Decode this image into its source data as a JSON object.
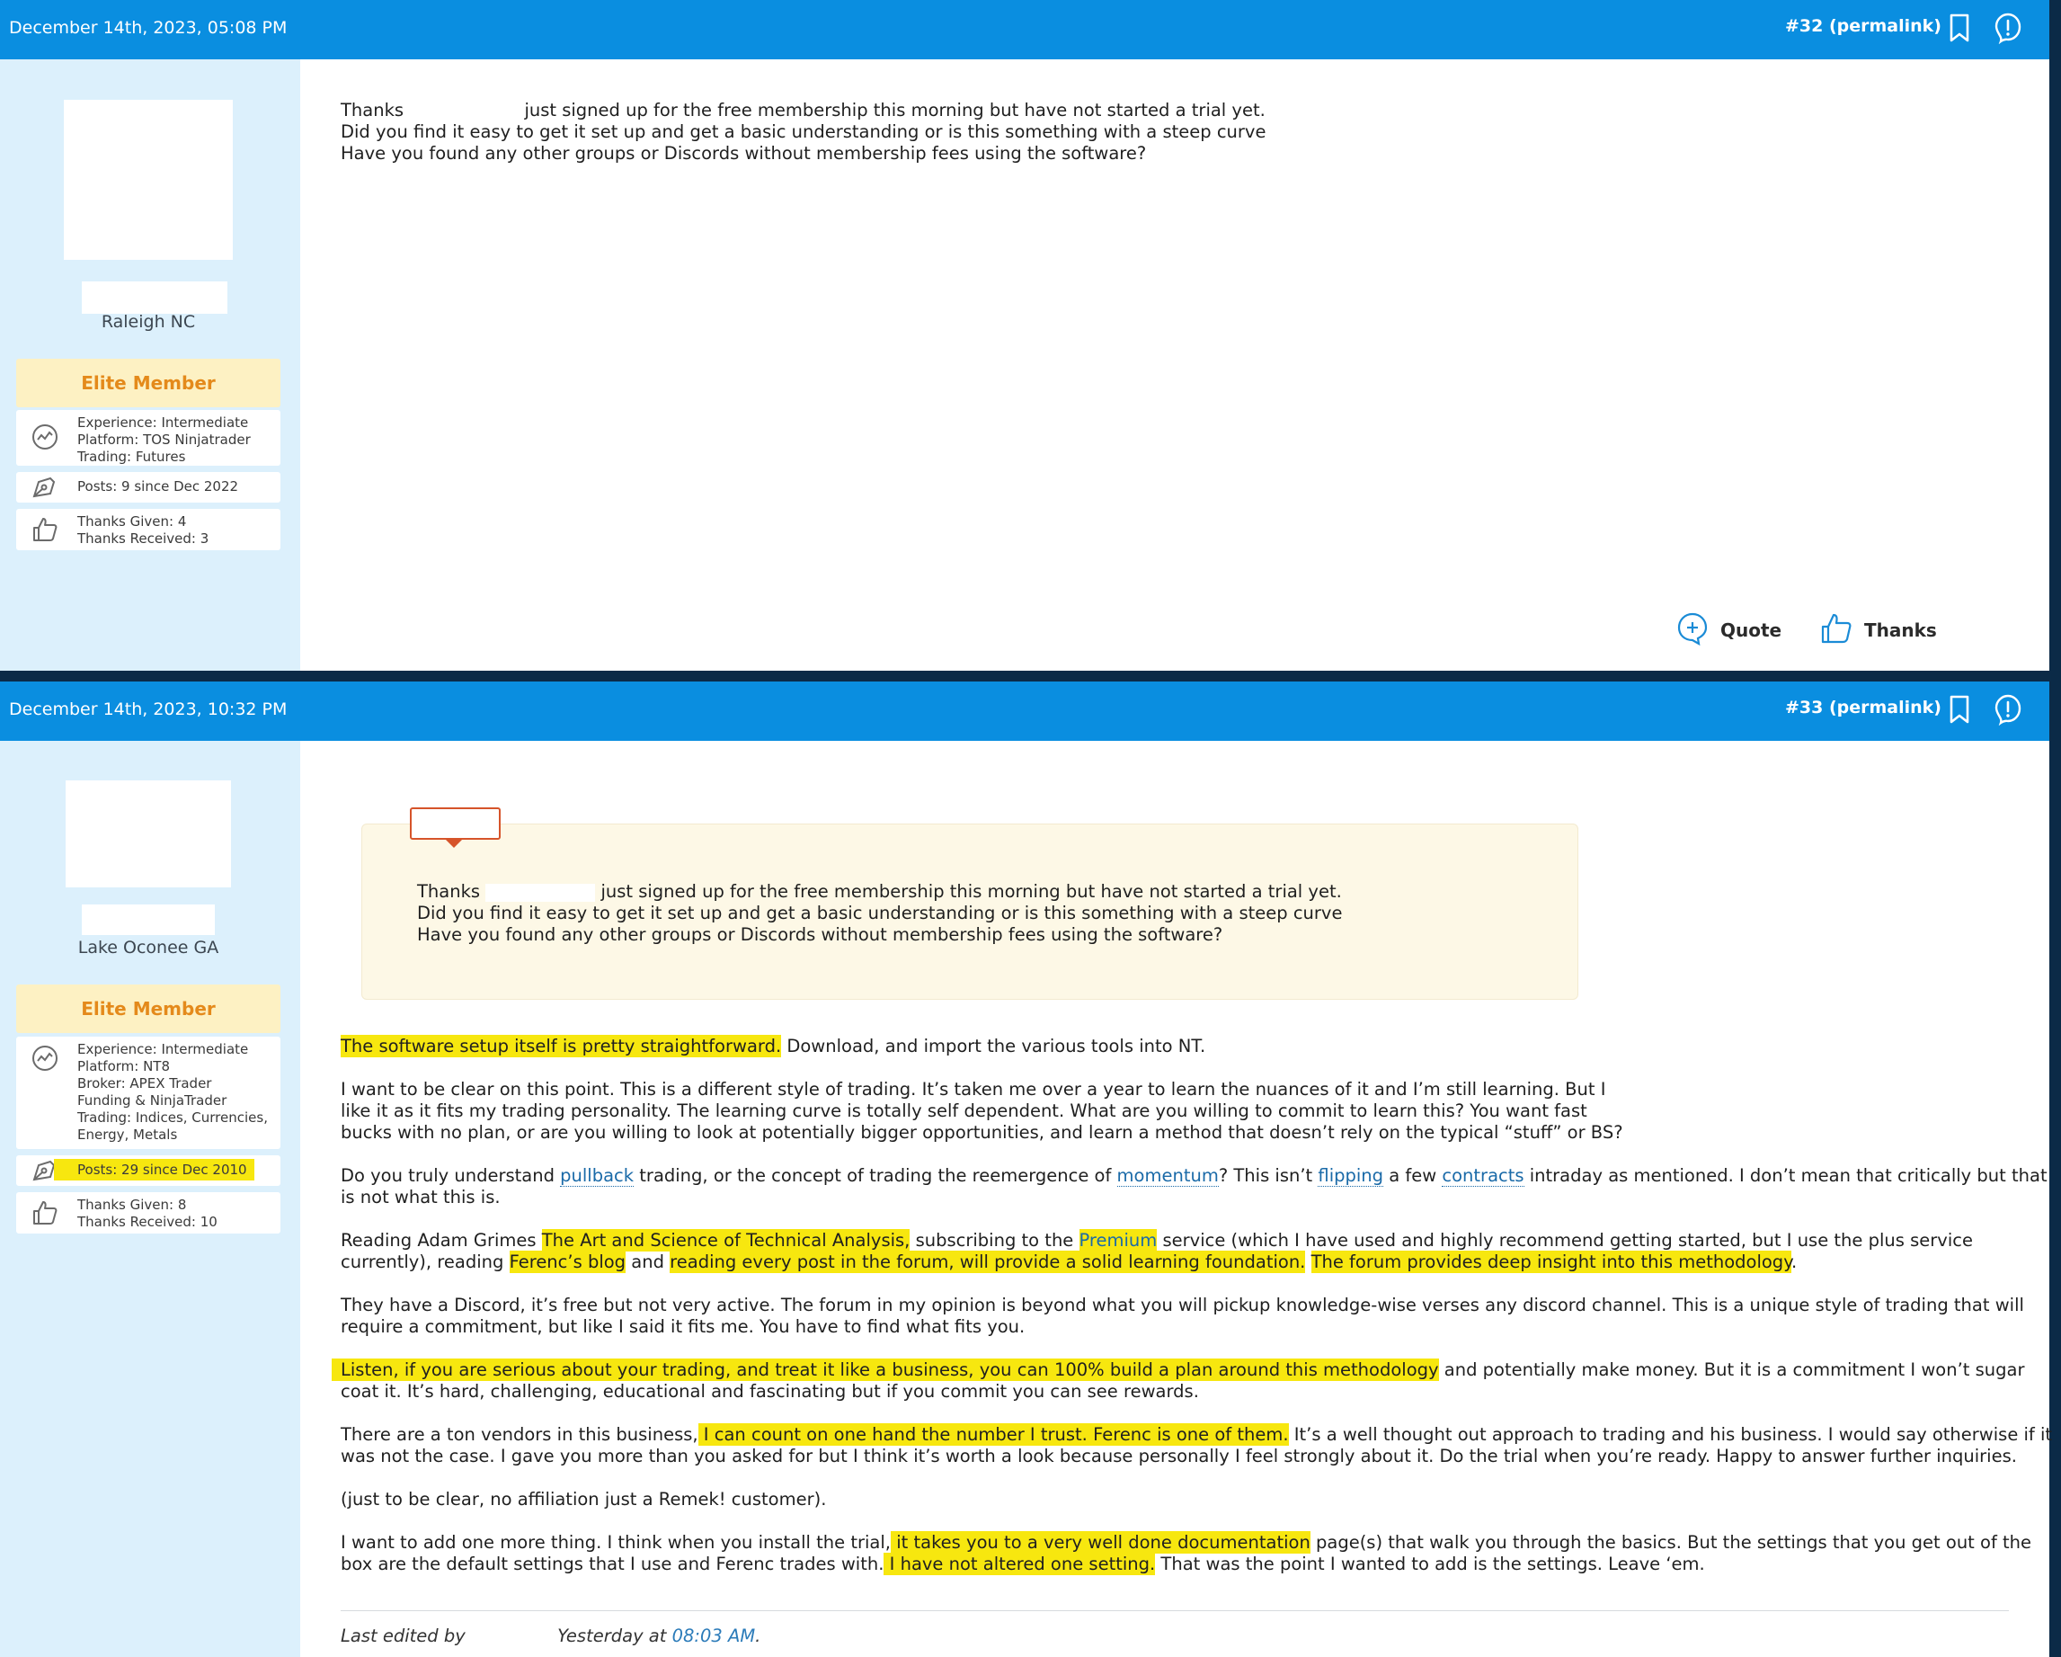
{
  "posts": [
    {
      "date": "December 14th, 2023, 05:08 PM",
      "permalink": "#32 (permalink)",
      "user": {
        "location": "Raleigh NC",
        "badge": "Elite Member",
        "experience": "Experience: Intermediate",
        "platform": "Platform: TOS Ninjatrader",
        "trading": "Trading: Futures",
        "posts": "Posts: 9 since Dec 2022",
        "thanks_given": "Thanks Given: 4",
        "thanks_received": "Thanks Received: 3"
      },
      "body": {
        "line1_a": "Thanks",
        "line1_b": "just signed up for the free membership this morning but have not started a trial yet.",
        "line2": "Did you find it easy to get it set up and get a basic understanding or is this something with a steep curve",
        "line3": "Have you found any other groups or Discords without membership fees using the software?"
      },
      "actions": {
        "quote": "Quote",
        "thanks": "Thanks"
      }
    },
    {
      "date": "December 14th, 2023, 10:32 PM",
      "permalink": "#33 (permalink)",
      "user": {
        "location": "Lake Oconee GA",
        "badge": "Elite Member",
        "experience": "Experience: Intermediate",
        "platform": "Platform: NT8",
        "broker1": "Broker: APEX Trader",
        "broker2": "Funding & NinjaTrader",
        "trading1": "Trading: Indices, Currencies,",
        "trading2": "Energy, Metals",
        "posts": "Posts: 29 since Dec 2010",
        "thanks_given": "Thanks Given: 8",
        "thanks_received": "Thanks Received: 10"
      },
      "quote": {
        "line1_a": "Thanks",
        "line1_b": "just signed up for the free membership this morning but have not started a trial yet.",
        "line2": "Did you find it easy to get it set up and get a basic understanding or is this something with a steep curve",
        "line3": "Have you found any other groups or Discords without membership fees using the software?"
      },
      "body": {
        "p1_hl": "The software setup itself is pretty straightforward.",
        "p1_rest": " Download, and import the various tools into NT.",
        "p2_l1": "I want to be clear on this point. This is a different style of trading. It’s taken me over a year to learn the nuances of it and I’m still learning. But I",
        "p2_l2": "like it as it fits my trading personality. The learning curve is totally self dependent. What are you willing to commit to learn this? You want fast",
        "p2_l3": "bucks with no plan, or are you willing to look at potentially bigger opportunities, and learn a method that doesn’t rely on the typical “stuff” or BS?",
        "p3_a": "Do you truly understand ",
        "p3_link1": "pullback",
        "p3_b": " trading, or the concept of trading the reemergence of ",
        "p3_link2": "momentum",
        "p3_c": "? This isn’t ",
        "p3_link3": "flipping",
        "p3_d": " a few ",
        "p3_link4": "contracts",
        "p3_e": " intraday as mentioned. I don’t mean that critically but that",
        "p3_l2": "is not what this is.",
        "p4_a": "Reading Adam Grimes ",
        "p4_hl1": "The Art and Science of Technical Analysis,",
        "p4_b": " subscribing to the ",
        "p4_link": "Premium",
        "p4_c": " service (which I have used and highly recommend getting started, but I use the plus service",
        "p4_d": "currently), reading ",
        "p4_hl2": "Ferenc’s blog",
        "p4_e": " and ",
        "p4_hl3": "reading every post in the forum, will provide a solid learning foundation.",
        "p4_f": " ",
        "p4_hl4": "The forum provides deep insight into this methodology",
        "p4_g": ".",
        "p5_l1": "They have a Discord, it’s free but not very active. The forum in my opinion is beyond what you will pickup knowledge-wise verses any discord channel. This is a unique style of trading that will",
        "p5_l2": "require a commitment, but like I said it fits me. You have to find what fits you.",
        "p6_hl": "Listen, if you are serious about your trading, and treat it like a business, you can 100% build a plan around this methodology",
        "p6_rest": " and potentially make money. But it is a commitment I won’t sugar",
        "p6_l2": "coat it. It’s hard, challenging, educational and fascinating but if you commit you can see rewards.",
        "p7_a": "There are a ton vendors in this business,",
        "p7_hl": " I can count on one hand the number I trust. Ferenc is one of them.",
        "p7_b": " It’s a well thought out approach to trading and his business. I would say otherwise if it",
        "p7_l2": "was not the case. I gave you more than you asked for but I think it’s worth a look because personally I feel strongly about it. Do the trial when you’re ready. Happy to answer further inquiries.",
        "p8": "(just to be clear, no affiliation just a Remek! customer).",
        "p9_a": "I want to add one more thing. I think when you install the trial,",
        "p9_hl1": " it takes you to a very well done documentation",
        "p9_b": " page(s) that walk you through the basics. But the settings that you get out of the",
        "p9_c": "box are the default settings that I use and Ferenc trades with.",
        "p9_hl2": " I have not altered one setting.",
        "p9_d": " That was the point I wanted to add is the settings. Leave ‘em."
      },
      "edited": {
        "prefix": "Last edited by",
        "when": "Yesterday at",
        "time": "08:03 AM",
        "suffix": "."
      }
    }
  ],
  "colors": {
    "header": "#0a8ee0",
    "sidebar": "#dcf0fc",
    "badge_text": "#e48a1b",
    "highlight": "#f7e70f"
  }
}
